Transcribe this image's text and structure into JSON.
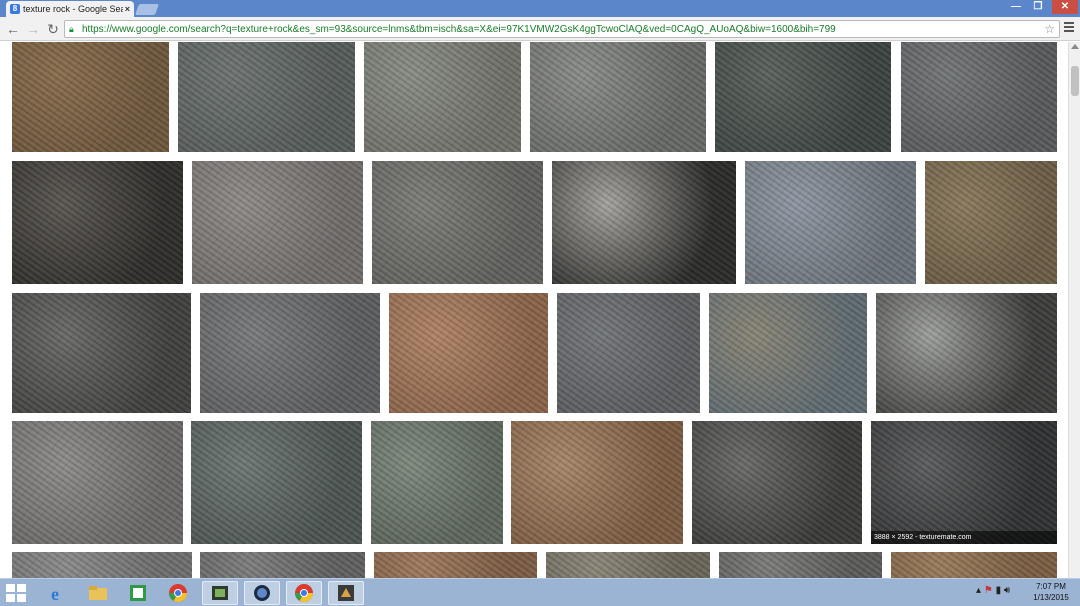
{
  "browser": {
    "tab_title": "texture rock - Google Sea",
    "tab_close": "×",
    "favicon_letter": "8",
    "url": "https://www.google.com/search?q=texture+rock&es_sm=93&source=lnms&tbm=isch&sa=X&ei=97K1VMW2GsK4ggTcwoClAQ&ved=0CAgQ_AUoAQ&biw=1600&bih=799",
    "window_buttons": {
      "minimize": "—",
      "maximize": "❐",
      "close": "✕"
    },
    "nav": {
      "back": "←",
      "forward": "→",
      "reload": "↻"
    },
    "icons": [
      "lock-icon",
      "star-icon",
      "menu-icon",
      "back-arrow-icon",
      "forward-arrow-icon",
      "reload-icon"
    ]
  },
  "results": {
    "rows": [
      {
        "items": [
          {
            "alt": "brown rock texture",
            "colors": [
              "#8a6e4e",
              "#6d563c"
            ]
          },
          {
            "alt": "grey cracked rock texture",
            "colors": [
              "#6e7472",
              "#555b58"
            ]
          },
          {
            "alt": "grey lichen rock texture",
            "colors": [
              "#8a8d86",
              "#6f7069"
            ]
          },
          {
            "alt": "grey pitted rock texture",
            "colors": [
              "#8b8d8a",
              "#666865"
            ]
          },
          {
            "alt": "dark green slate rock texture",
            "colors": [
              "#5b625d",
              "#3b423f"
            ]
          },
          {
            "alt": "grey granite rock texture",
            "colors": [
              "#747778",
              "#57595a"
            ]
          }
        ]
      },
      {
        "items": [
          {
            "alt": "black white rough rock texture",
            "colors": [
              "#5a5752",
              "#2e2c29"
            ]
          },
          {
            "alt": "grey speckled rock texture",
            "colors": [
              "#8f8b88",
              "#6f6b69"
            ]
          },
          {
            "alt": "grey weathered rock texture",
            "colors": [
              "#7d7e79",
              "#5f605c"
            ]
          },
          {
            "alt": "grey black lichen rock texture",
            "colors": [
              "#a5a39e",
              "#2a2a28"
            ]
          },
          {
            "alt": "blue grey rock texture",
            "colors": [
              "#8e98a3",
              "#6a7178"
            ]
          },
          {
            "alt": "brown tan rock texture",
            "colors": [
              "#8c7a5e",
              "#6b5c45"
            ]
          }
        ]
      },
      {
        "items": [
          {
            "alt": "dark cracked rock texture",
            "colors": [
              "#6a6a68",
              "#3f3f3d"
            ]
          },
          {
            "alt": "grey granular rock texture",
            "colors": [
              "#7a7b7d",
              "#5b5c5e"
            ]
          },
          {
            "alt": "orange sandstone rock texture",
            "colors": [
              "#b08466",
              "#8a6249"
            ]
          },
          {
            "alt": "smooth grey rock texture",
            "colors": [
              "#747779",
              "#5a5c5f"
            ]
          },
          {
            "alt": "multicolor rock texture",
            "colors": [
              "#8a8576",
              "#5e6a70"
            ]
          },
          {
            "alt": "stone wall rock texture",
            "colors": [
              "#9ea09c",
              "#3b3c3a"
            ]
          }
        ]
      },
      {
        "items": [
          {
            "alt": "pale grey rock texture",
            "colors": [
              "#8e8c8a",
              "#6a6866"
            ]
          },
          {
            "alt": "green grey layered rock texture",
            "colors": [
              "#6f7875",
              "#4b5350"
            ]
          },
          {
            "alt": "green grey rough rock texture",
            "colors": [
              "#7f8a7e",
              "#5d665d"
            ]
          },
          {
            "alt": "rusty veined rock texture",
            "colors": [
              "#a8876b",
              "#7a5a40"
            ]
          },
          {
            "alt": "dark jagged rock texture",
            "colors": [
              "#6b6b69",
              "#393938"
            ]
          },
          {
            "alt": "dark layered rock texture",
            "colors": [
              "#5c5d5e",
              "#2f3031"
            ],
            "caption": "3888 × 2592 - texturemate.com"
          }
        ]
      },
      {
        "items": [
          {
            "alt": "grey rock texture partial",
            "colors": [
              "#8a8b8a",
              "#6d6e6d"
            ]
          },
          {
            "alt": "grey rock texture partial",
            "colors": [
              "#7d7e7d",
              "#5f605f"
            ]
          },
          {
            "alt": "brown cracked rock texture partial",
            "colors": [
              "#a07a5e",
              "#7c5c44"
            ]
          },
          {
            "alt": "grey tan rock texture partial",
            "colors": [
              "#8c8778",
              "#6a6558"
            ]
          },
          {
            "alt": "grey rock texture partial",
            "colors": [
              "#7c7c7a",
              "#5a5a58"
            ]
          },
          {
            "alt": "brown rock texture partial",
            "colors": [
              "#9a7c5c",
              "#7a5e42"
            ]
          }
        ]
      }
    ]
  },
  "taskbar": {
    "apps": [
      "internet-explorer-icon",
      "file-explorer-icon",
      "calculator-icon",
      "chrome-icon",
      "media-icon",
      "cinema4d-icon",
      "chrome-icon",
      "app-icon"
    ],
    "time": "7:07 PM",
    "date": "1/13/2015"
  }
}
